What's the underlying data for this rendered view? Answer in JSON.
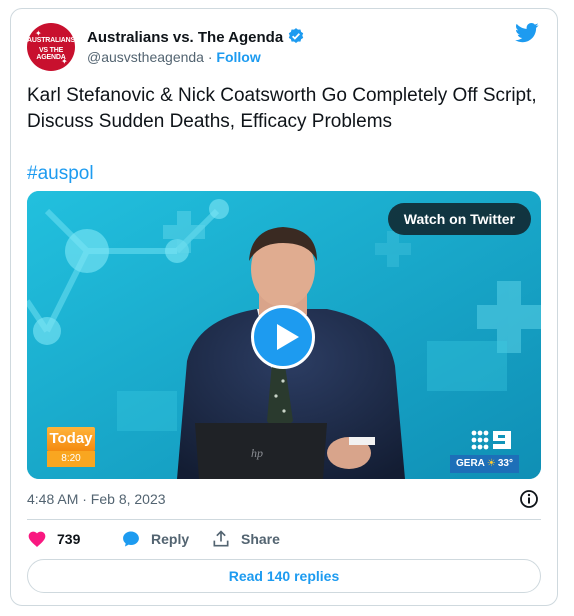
{
  "author": {
    "name": "Australians vs. The Agenda",
    "handle": "@ausvstheagenda",
    "separator": " · ",
    "follow_label": "Follow",
    "avatar_line1": "AUSTRALIANS",
    "avatar_line2": "VS THE AGENDA"
  },
  "tweet": {
    "text": "Karl Stefanovic & Nick Coatsworth Go Completely Off Script, Discuss Sudden Deaths, Efficacy Problems",
    "hashtag": "#auspol"
  },
  "media": {
    "watch_label": "Watch on Twitter",
    "today_label": "Today",
    "today_time": "8:20",
    "weather_location": "GERA",
    "weather_temp": "33°"
  },
  "meta": {
    "timestamp": "4:48 AM · Feb 8, 2023"
  },
  "actions": {
    "like_count": "739",
    "reply_label": "Reply",
    "share_label": "Share"
  },
  "read_replies_label": "Read 140 replies",
  "colors": {
    "accent": "#1d9bf0",
    "like": "#f91880",
    "muted": "#536471",
    "border": "#cfd9de",
    "avatar_bg": "#c8102e"
  },
  "icons": [
    "verified-badge-icon",
    "twitter-bird-icon",
    "play-icon",
    "info-icon",
    "heart-icon",
    "reply-bubble-icon",
    "share-icon"
  ]
}
